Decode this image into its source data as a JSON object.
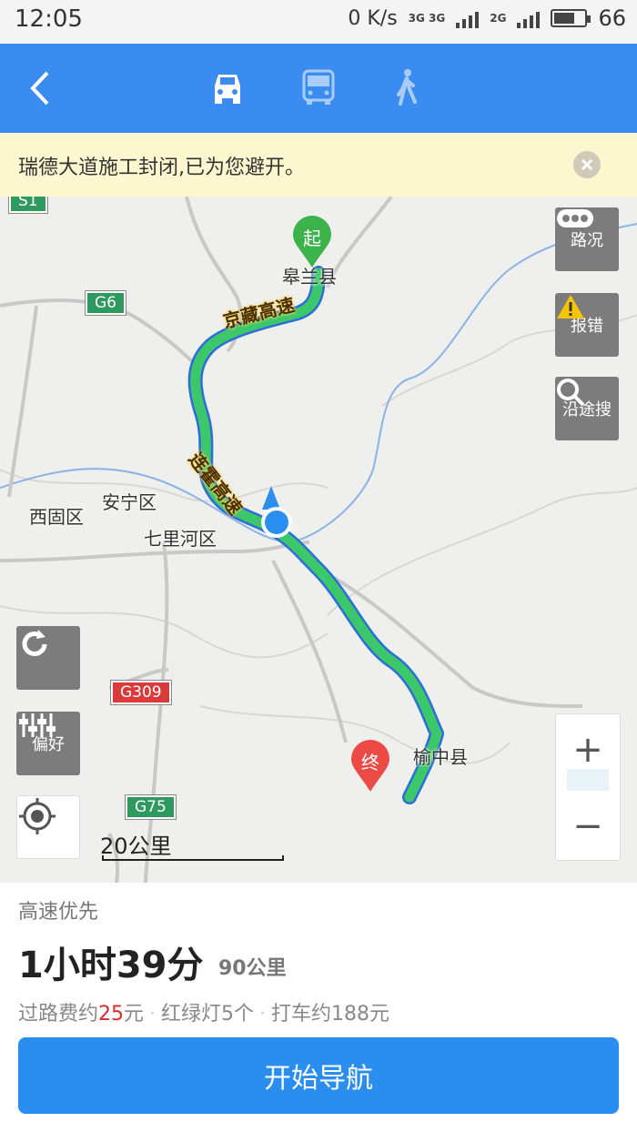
{
  "status_bar": {
    "time": "12:05",
    "speed": "0 K/s",
    "net_1": "3G 3G",
    "net_2": "2G",
    "battery": "66"
  },
  "topbar": {
    "modes": [
      "car-icon",
      "bus-icon",
      "walk-icon"
    ],
    "selected_mode": "car"
  },
  "notice": {
    "text": "瑞德大道施工封闭,已为您避开。"
  },
  "map": {
    "labels": {
      "start_town": "皋兰县",
      "anning": "安宁区",
      "xigu": "西固区",
      "qilihe": "七里河区",
      "yuzhong": "榆中县"
    },
    "road_names": {
      "jingzang": "京藏高速",
      "lianhuo": "连霍高速"
    },
    "shields": {
      "g6": "G6",
      "g309": "G309",
      "g75": "G75",
      "s1": "S1"
    },
    "start_marker": "起",
    "end_marker": "终",
    "side_buttons": {
      "traffic": "路况",
      "report": "报错",
      "search_along": "沿途搜",
      "preference": "偏好"
    },
    "zoom": {
      "plus": "+",
      "minus": "−"
    },
    "scale": "20公里"
  },
  "route": {
    "preference": "高速优先",
    "duration": "1小时39分",
    "distance": "90公里",
    "toll_prefix": "过路费约",
    "toll_value": "25",
    "toll_unit": "元",
    "lights": "红绿灯5个",
    "taxi": "打车约188元"
  },
  "start_button": "开始导航",
  "colors": {
    "brand_blue": "#3b8cf1",
    "route_green": "#3cc76a",
    "toll_red": "#d82b2b"
  }
}
